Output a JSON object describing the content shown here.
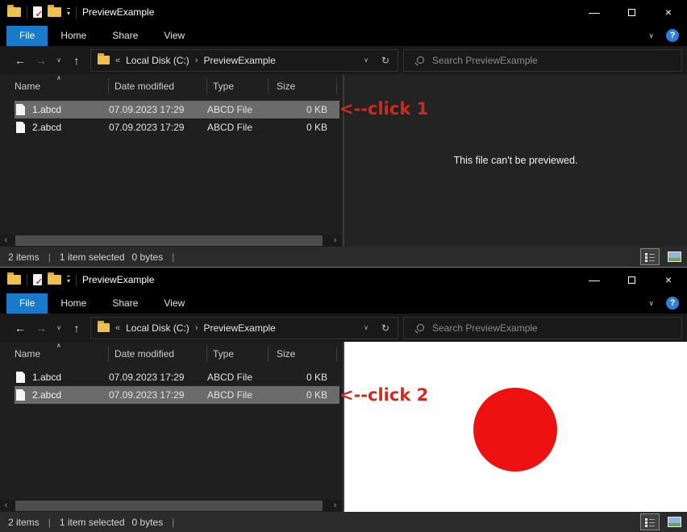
{
  "colors": {
    "file_tab_blue": "#1979ca",
    "selection_gray": "#6b6b6b",
    "annotation_red": "#d02a1f",
    "circle_red": "#ee1111",
    "help_blue": "#2f7fd6",
    "folder_yellow": "#eec14f"
  },
  "icons": {
    "back": "←",
    "forward": "→",
    "up": "↑",
    "dropdown": "∨",
    "toolbar_dropdown": "▾",
    "refresh": "↻",
    "breadcrumb_overflow": "«",
    "breadcrumb_sep": "›",
    "sort_ascending": "∧",
    "scroll_left": "‹",
    "scroll_right": "›",
    "help": "?",
    "minimize": "—",
    "close": "×",
    "pipe": "|"
  },
  "windows": [
    {
      "title": "PreviewExample",
      "tabs": [
        "File",
        "Home",
        "Share",
        "View"
      ],
      "address": {
        "root": "Local Disk (C:)",
        "folder": "PreviewExample"
      },
      "search_placeholder": "Search PreviewExample",
      "columns": {
        "name": "Name",
        "date": "Date modified",
        "type": "Type",
        "size": "Size"
      },
      "rows": [
        {
          "name": "1.abcd",
          "date": "07.09.2023 17:29",
          "type": "ABCD File",
          "size": "0 KB",
          "selected": true
        },
        {
          "name": "2.abcd",
          "date": "07.09.2023 17:29",
          "type": "ABCD File",
          "size": "0 KB",
          "selected": false
        }
      ],
      "annotation": "<--click 1",
      "preview_message": "This file can't be previewed.",
      "status": {
        "items": "2 items",
        "selected": "1 item selected",
        "size": "0 bytes"
      }
    },
    {
      "title": "PreviewExample",
      "tabs": [
        "File",
        "Home",
        "Share",
        "View"
      ],
      "address": {
        "root": "Local Disk (C:)",
        "folder": "PreviewExample"
      },
      "search_placeholder": "Search PreviewExample",
      "columns": {
        "name": "Name",
        "date": "Date modified",
        "type": "Type",
        "size": "Size"
      },
      "rows": [
        {
          "name": "1.abcd",
          "date": "07.09.2023 17:29",
          "type": "ABCD File",
          "size": "0 KB",
          "selected": false
        },
        {
          "name": "2.abcd",
          "date": "07.09.2023 17:29",
          "type": "ABCD File",
          "size": "0 KB",
          "selected": true
        }
      ],
      "annotation": "<--click 2",
      "status": {
        "items": "2 items",
        "selected": "1 item selected",
        "size": "0 bytes"
      }
    }
  ]
}
